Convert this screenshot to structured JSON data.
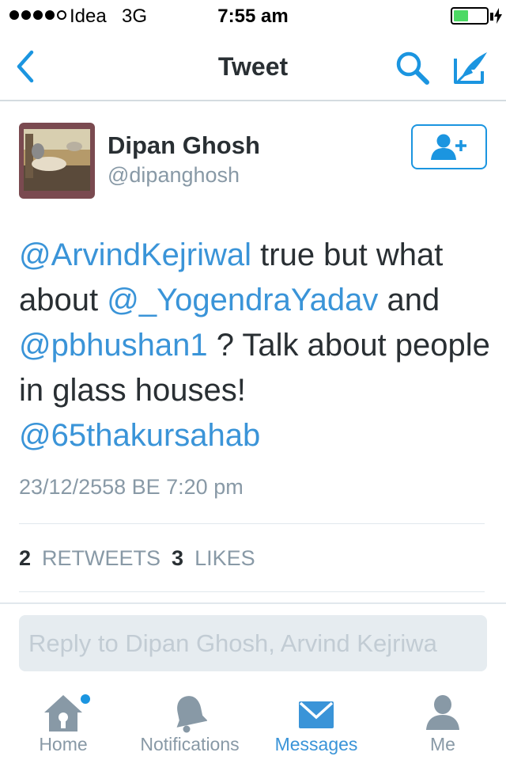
{
  "status_bar": {
    "carrier": "Idea",
    "network": "3G",
    "time": "7:55 am",
    "signal_bars_filled": 4,
    "signal_bars_total": 5,
    "battery_level": 0.45
  },
  "nav": {
    "title": "Tweet",
    "back_icon": "chevron-left-icon",
    "search_icon": "search-icon",
    "compose_icon": "compose-icon"
  },
  "tweet": {
    "author_name": "Dipan Ghosh",
    "author_handle": "@dipanghosh",
    "follow_icon": "add-user-icon",
    "text_parts": {
      "m1": "@ArvindKejriwal",
      "t1": " true but what about ",
      "m2": "@_YogendraYadav",
      "t2": " and ",
      "m3": "@pbhushan1",
      "t3": " ? Talk about people in glass houses! ",
      "m4": "@65thakursahab"
    },
    "timestamp": "23/12/2558 BE 7:20 pm",
    "retweet_count": "2",
    "retweet_label": "RETWEETS",
    "like_count": "3",
    "like_label": "LIKES"
  },
  "reply": {
    "placeholder": "Reply to Dipan Ghosh, Arvind Kejriwa"
  },
  "tabs": [
    {
      "label": "Home",
      "icon": "home-icon",
      "active": false,
      "has_badge": true
    },
    {
      "label": "Notifications",
      "icon": "bell-icon",
      "active": false
    },
    {
      "label": "Messages",
      "icon": "envelope-icon",
      "active": true
    },
    {
      "label": "Me",
      "icon": "person-icon",
      "active": false
    }
  ],
  "colors": {
    "accent": "#1b95e0",
    "link": "#3a94d8",
    "text": "#292f33",
    "muted": "#8899a6",
    "battery": "#4cd964"
  }
}
